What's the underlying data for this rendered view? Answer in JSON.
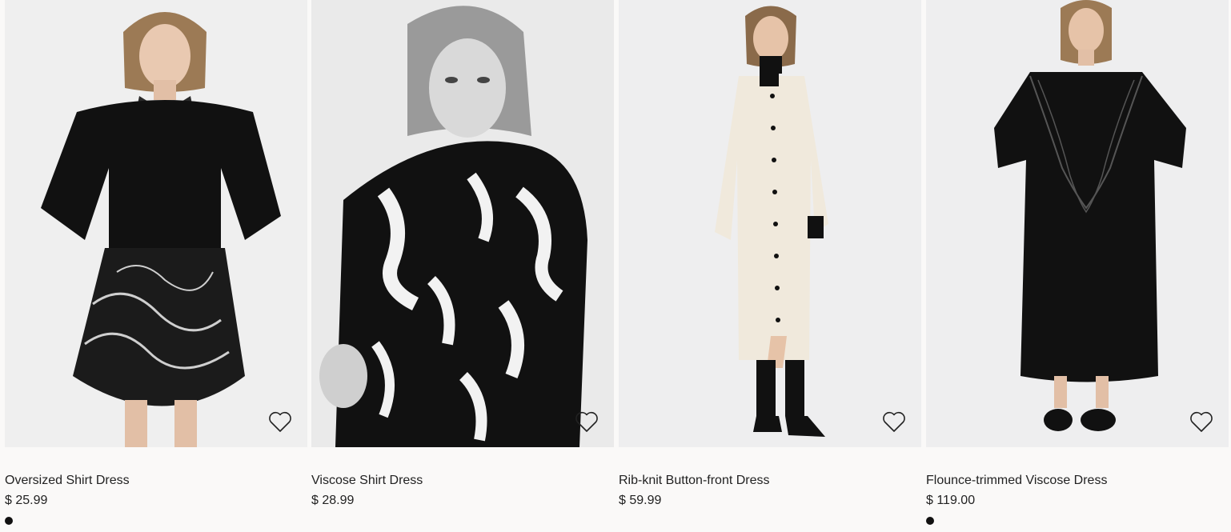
{
  "products": [
    {
      "name": "Oversized Shirt Dress",
      "price": "$ 25.99",
      "photo_subject": "woman in black sweater over paisley print shirt dress",
      "favorite_icon": "heart-outline-icon",
      "swatch_color": "#111111",
      "has_swatch": true
    },
    {
      "name": "Viscose Shirt Dress",
      "price": "$ 28.99",
      "photo_subject": "woman in black and white abstract print shirt dress",
      "favorite_icon": "heart-outline-icon",
      "has_swatch": false
    },
    {
      "name": "Rib-knit Button-front Dress",
      "price": "$ 59.99",
      "photo_subject": "woman in cream rib-knit button-front dress",
      "favorite_icon": "heart-outline-icon",
      "has_swatch": false
    },
    {
      "name": "Flounce-trimmed Viscose Dress",
      "price": "$ 119.00",
      "photo_subject": "woman in black flounce-trimmed viscose dress",
      "favorite_icon": "heart-outline-icon",
      "swatch_color": "#111111",
      "has_swatch": true
    }
  ],
  "colors": {
    "page_background": "#faf9f8",
    "photo_background": "#eeeeee",
    "text": "#222222"
  }
}
